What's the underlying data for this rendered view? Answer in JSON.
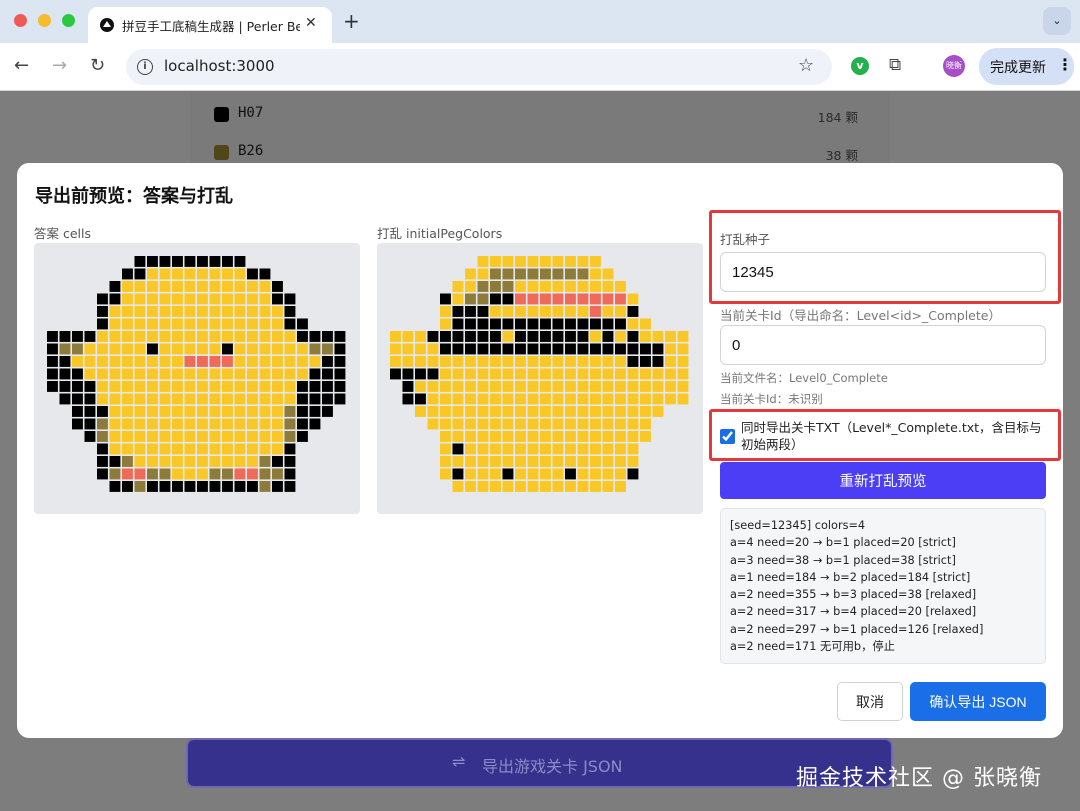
{
  "browser": {
    "tab_title": "拼豆手工底稿生成器 | Perler Be",
    "url": "localhost:3000",
    "profile_initials": "晓衡",
    "update_label": "完成更新"
  },
  "background": {
    "colors": [
      {
        "code": "H07",
        "count": "184 颗",
        "swatch": "#000000"
      },
      {
        "code": "B26",
        "count": "38 颗",
        "swatch": "#5a4f1c"
      }
    ],
    "export_button": "导出游戏关卡 JSON"
  },
  "modal": {
    "title": "导出前预览：答案与打乱",
    "answer_label": "答案 cells",
    "shuffle_label": "打乱 initialPegColors",
    "seed_label": "打乱种子",
    "seed_value": "12345",
    "level_label": "当前关卡Id（导出命名：Level<id>_Complete）",
    "level_value": "0",
    "filename_text": "当前文件名：Level0_Complete",
    "levelid_text": "当前关卡Id：未识别",
    "export_txt_label": "同时导出关卡TXT（Level*_Complete.txt，含目标与初始两段）",
    "export_txt_checked": true,
    "reshuffle_button": "重新打乱预览",
    "log_lines": [
      "[seed=12345] colors=4",
      "a=4 need=20 → b=1 placed=20 [strict]",
      "a=3 need=38 → b=1 placed=38 [strict]",
      "a=1 need=184 → b=2 placed=184 [strict]",
      "a=2 need=355 → b=3 placed=38 [relaxed]",
      "a=2 need=317 → b=4 placed=20 [relaxed]",
      "a=2 need=297 → b=1 placed=126 [relaxed]",
      "a=2 need=171 无可用b，停止"
    ],
    "cancel_button": "取消",
    "confirm_button": "确认导出 JSON"
  },
  "watermark": "掘金技术社区 @ 张晓衡",
  "palette": {
    "1": "#000000",
    "2": "#f9c726",
    "3": "#8c7b3a",
    "4": "#f06a5a"
  },
  "patterns": {
    "answer": [
      "..........................",
      "........KKKKKKKKK.........",
      ".......KKYYYYYYYYKK.......",
      "......KYYYYYYYYYYYYK......",
      ".....KKYYYYYYYYYYYYKK.....",
      ".....KYYYYYYYYYYYYYYK.....",
      ".....KYYYYYYYYYYYYYYKK....",
      ".KKKKYYYYYYYYYYYYYYYYKKKK.",
      ".KBBYYYYYKYYYYYKYYYYYYBBK.",
      ".KKYYYYYYYYYRRRRYYYYYYYKK.",
      ".KKKYYYYYYYYYYYYYYYYYYKKK.",
      ".KKKKYYYYYYYYYYYYYYYYKKKK.",
      "..KKKYYYYYYYYYYYYYYYYKKKK.",
      "...KKKYYYYYYYYYYYYYYBKKK..",
      "...KKBYYYYYYYYYYYYYYBKK...",
      "....KBYYYYYYYYYYYYYYBK....",
      ".....KYYYYYYYYYYYYYYK.....",
      ".....KKBYYYYYYYYYYBKK.....",
      ".....KBRRBBYYYBBRRBBK.....",
      "......KKBKKKKKKKKKBKK.....",
      "..........................",
      ".........................."
    ],
    "shuffle": [
      "..........................",
      "........YYYYYYYYYY........",
      ".......YYBBBBBBBBYY.......",
      "......YYBBBYYYYYYYYY......",
      ".....KYBBKKRRRRRRRRRY.....",
      ".....YKKKYYYYYYYYRYYK.....",
      ".....YKKKKKKKKKKKKKKYY....",
      ".YYYKKKKKKYKKKKKKYKYKYYYY.",
      ".YYYYKKKKKKKKKKKKKKKKKKYY.",
      ".YYYYYYYYYYYYYYYYYYYKKKYY.",
      ".KKKKYYYYYYYYYYYYYYYYYYYY.",
      "..KYYYYYYYYYYYYYYYYYYYYYY.",
      "..KKYYYYYYYYYYYYYYYYYYYYY.",
      "...YYYYYYYYYYYYYYYYYYYY...",
      "....YYYYYYYYYYYYYYYYYY....",
      ".....YYYYYYYYYYYYYYYYY....",
      ".....YKYYYYYYYYYYYYYY.....",
      ".....YYYYYYYYYYYYYYYY.....",
      ".....YKYYYKYYYYKYYYYK.....",
      "......YYYYYYYYYYYYYY......",
      "..........................",
      ".........................."
    ]
  }
}
